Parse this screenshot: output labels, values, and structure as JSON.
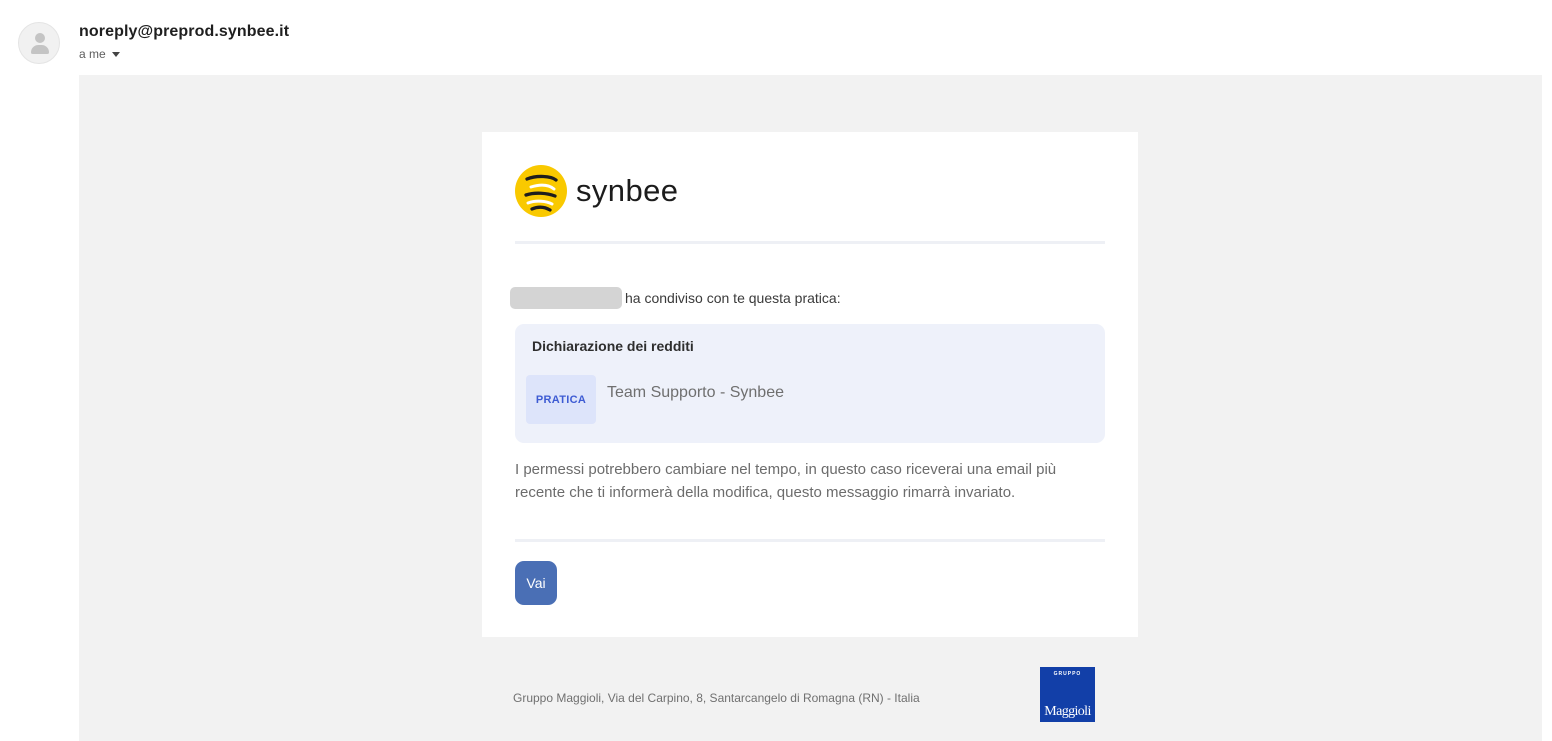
{
  "header": {
    "sender": "noreply@preprod.synbee.it",
    "recipient": "a me",
    "recipient_menu_icon": "caret-down-icon",
    "avatar_icon": "person-icon"
  },
  "email": {
    "logo": {
      "icon": "synbee-logo-icon",
      "text": "synbee",
      "color": "#F9C900"
    },
    "share_text": "ha condiviso con te questa pratica:",
    "practice": {
      "title": "Dichiarazione dei redditi",
      "tag": "PRATICA",
      "team": "Team Supporto - Synbee"
    },
    "permissions_text": "I permessi potrebbero cambiare nel tempo, in questo caso riceverai una email più recente che ti informerà della modifica, questo messaggio rimarrà invariato.",
    "button_label": "Vai",
    "button_color": "#4A6FB5"
  },
  "footer": {
    "address": "Gruppo Maggioli, Via del Carpino, 8, Santarcangelo di Romagna (RN) - Italia",
    "logo_top": "GRUPPO",
    "logo_name": "Maggioli",
    "logo_color": "#123FA8"
  }
}
